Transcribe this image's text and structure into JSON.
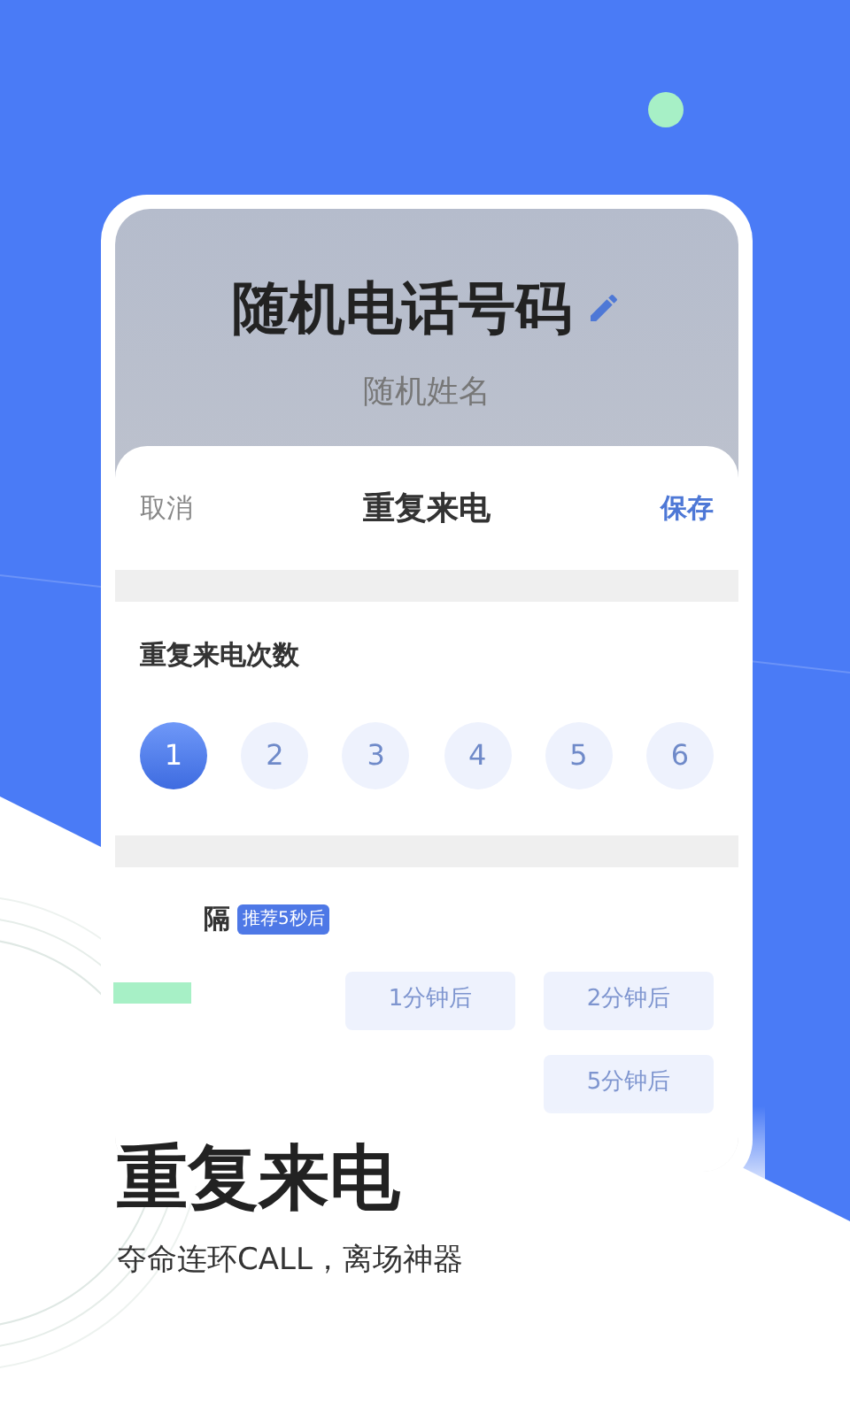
{
  "phone": {
    "title": "随机电话号码",
    "subtitle": "随机姓名"
  },
  "sheet": {
    "cancel": "取消",
    "title": "重复来电",
    "save": "保存",
    "count_label": "重复来电次数",
    "count_options": [
      {
        "label": "1",
        "selected": true
      },
      {
        "label": "2",
        "selected": false
      },
      {
        "label": "3",
        "selected": false
      },
      {
        "label": "4",
        "selected": false
      },
      {
        "label": "5",
        "selected": false
      },
      {
        "label": "6",
        "selected": false
      }
    ],
    "interval_label": "隔",
    "interval_badge": "推荐5秒后",
    "interval_options": [
      {
        "label": "1分钟后"
      },
      {
        "label": "2分钟后"
      },
      {
        "label": "5分钟后"
      }
    ]
  },
  "promo": {
    "title": "重复来电",
    "subtitle": "夺命连环CALL，离场神器"
  }
}
